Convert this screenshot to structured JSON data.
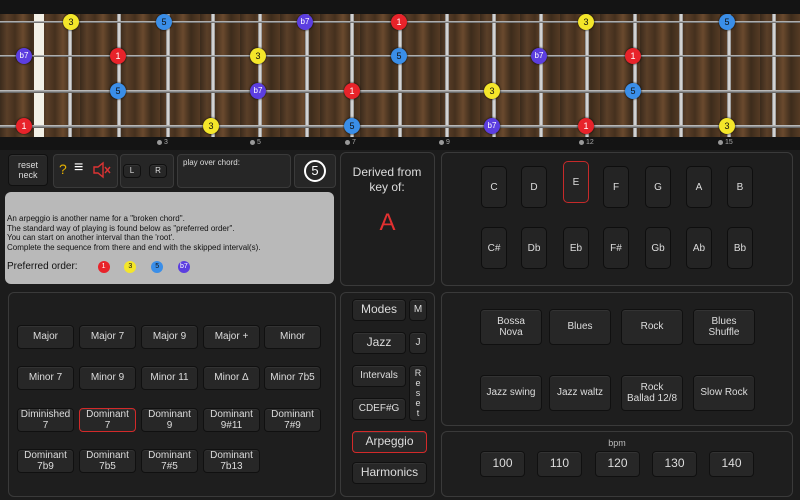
{
  "neck": {
    "fret_markers": [
      "3",
      "5",
      "7",
      "9",
      "12",
      "15"
    ],
    "notes": [
      {
        "label": "3",
        "color": "c3",
        "string": 1,
        "fret": 1
      },
      {
        "label": "5",
        "color": "c5",
        "string": 1,
        "fret": 3
      },
      {
        "label": "b7",
        "color": "cb7",
        "string": 1,
        "fret": 6
      },
      {
        "label": "1",
        "color": "c1",
        "string": 1,
        "fret": 8
      },
      {
        "label": "3",
        "color": "c3",
        "string": 1,
        "fret": 12
      },
      {
        "label": "5",
        "color": "c5",
        "string": 1,
        "fret": 15
      },
      {
        "label": "b7",
        "color": "cb7",
        "string": 2,
        "fret": 0
      },
      {
        "label": "1",
        "color": "c1",
        "string": 2,
        "fret": 2
      },
      {
        "label": "3",
        "color": "c3",
        "string": 2,
        "fret": 5
      },
      {
        "label": "5",
        "color": "c5",
        "string": 2,
        "fret": 8
      },
      {
        "label": "b7",
        "color": "cb7",
        "string": 2,
        "fret": 11
      },
      {
        "label": "1",
        "color": "c1",
        "string": 2,
        "fret": 13
      },
      {
        "label": "5",
        "color": "c5",
        "string": 3,
        "fret": 2
      },
      {
        "label": "b7",
        "color": "cb7",
        "string": 3,
        "fret": 5
      },
      {
        "label": "1",
        "color": "c1",
        "string": 3,
        "fret": 7
      },
      {
        "label": "3",
        "color": "c3",
        "string": 3,
        "fret": 10
      },
      {
        "label": "5",
        "color": "c5",
        "string": 3,
        "fret": 13
      },
      {
        "label": "1",
        "color": "c1",
        "string": 4,
        "fret": 0
      },
      {
        "label": "3",
        "color": "c3",
        "string": 4,
        "fret": 4
      },
      {
        "label": "5",
        "color": "c5",
        "string": 4,
        "fret": 7
      },
      {
        "label": "b7",
        "color": "cb7",
        "string": 4,
        "fret": 10
      },
      {
        "label": "1",
        "color": "c1",
        "string": 4,
        "fret": 12
      },
      {
        "label": "3",
        "color": "c3",
        "string": 4,
        "fret": 15
      }
    ]
  },
  "controls": {
    "reset_neck": "reset\nneck",
    "help": "?",
    "menu": "≡",
    "mute": "mute",
    "left": "L",
    "right": "R",
    "play_over_chord": "play over chord:",
    "count": "5"
  },
  "info": {
    "lines": [
      "An arpeggio is another name for a \"broken chord\".",
      "The standard way of playing is found below as \"preferred order\".",
      "You can start on another interval than the 'root'.",
      "Complete the sequence from there and end with the skipped interval(s)."
    ],
    "preferred_label": "Preferred order:",
    "preferred": [
      "1",
      "3",
      "5",
      "b7"
    ]
  },
  "derived": {
    "title": "Derived from key of:",
    "key": "A"
  },
  "keys": {
    "row1": [
      "C",
      "D",
      "E",
      "F",
      "G",
      "A",
      "B"
    ],
    "row2": [
      "C#",
      "Db",
      "Eb",
      "F#",
      "Gb",
      "Ab",
      "Bb"
    ],
    "selected": "E"
  },
  "chords": [
    [
      "Major",
      "Major 7",
      "Major 9",
      "Major +",
      "Minor"
    ],
    [
      "Minor 7",
      "Minor 9",
      "Minor 11",
      "Minor Δ",
      "Minor 7b5"
    ],
    [
      "Diminished\n7",
      "Dominant\n7",
      "Dominant\n9",
      "Dominant\n9#11",
      "Dominant\n7#9"
    ],
    [
      "Dominant\n7b9",
      "Dominant\n7b5",
      "Dominant\n7#5",
      "Dominant\n7b13"
    ]
  ],
  "chord_selected": "Dominant\n7",
  "modes": {
    "modes": "Modes",
    "m": "M",
    "jazz": "Jazz",
    "j": "J",
    "intervals": "Intervals",
    "reset": "R\ne\ns\ne\nt",
    "cdef": "CDEF#G",
    "arpeggio": "Arpeggio",
    "harmonics": "Harmonics"
  },
  "styles": [
    [
      "Bossa\nNova",
      "Blues",
      "Rock",
      "Blues\nShuffle"
    ],
    [
      "Jazz swing",
      "Jazz waltz",
      "Rock\nBallad 12/8",
      "Slow Rock"
    ]
  ],
  "bpm": {
    "label": "bpm",
    "values": [
      "100",
      "110",
      "120",
      "130",
      "140"
    ]
  }
}
